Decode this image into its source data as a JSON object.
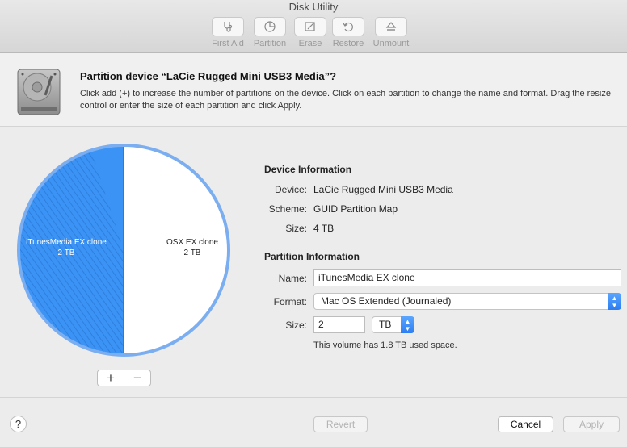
{
  "window": {
    "title": "Disk Utility"
  },
  "toolbar": {
    "items": [
      {
        "label": "First Aid",
        "icon": "stethoscope-icon"
      },
      {
        "label": "Partition",
        "icon": "pie-chart-icon"
      },
      {
        "label": "Erase",
        "icon": "erase-icon"
      },
      {
        "label": "Restore",
        "icon": "restore-icon"
      },
      {
        "label": "Unmount",
        "icon": "eject-icon"
      }
    ]
  },
  "header": {
    "title": "Partition device “LaCie Rugged Mini USB3 Media”?",
    "description": "Click add (+) to increase the number of partitions on the device. Click on each partition to change the name and format. Drag the resize control or enter the size of each partition and click Apply."
  },
  "partitions": [
    {
      "name": "iTunesMedia EX clone",
      "size": "2 TB",
      "fraction": 0.5,
      "color": "#3b93f5",
      "used_fraction": 0.9,
      "selected": true
    },
    {
      "name": "OSX EX clone",
      "size": "2 TB",
      "fraction": 0.5,
      "color": "#ffffff",
      "selected": false
    }
  ],
  "partition_controls": {
    "add": "+",
    "remove": "−"
  },
  "device_info": {
    "title": "Device Information",
    "device_label": "Device:",
    "device_value": "LaCie Rugged Mini USB3 Media",
    "scheme_label": "Scheme:",
    "scheme_value": "GUID Partition Map",
    "size_label": "Size:",
    "size_value": "4 TB"
  },
  "partition_info": {
    "title": "Partition Information",
    "name_label": "Name:",
    "name_value": "iTunesMedia EX clone",
    "format_label": "Format:",
    "format_value": "Mac OS Extended (Journaled)",
    "size_label": "Size:",
    "size_value": "2",
    "size_unit": "TB",
    "used_note": "This volume has 1.8 TB used space."
  },
  "footer": {
    "help": "?",
    "revert": "Revert",
    "cancel": "Cancel",
    "apply": "Apply"
  },
  "colors": {
    "accent": "#2c7df2",
    "pie_border": "#7aaef0"
  }
}
